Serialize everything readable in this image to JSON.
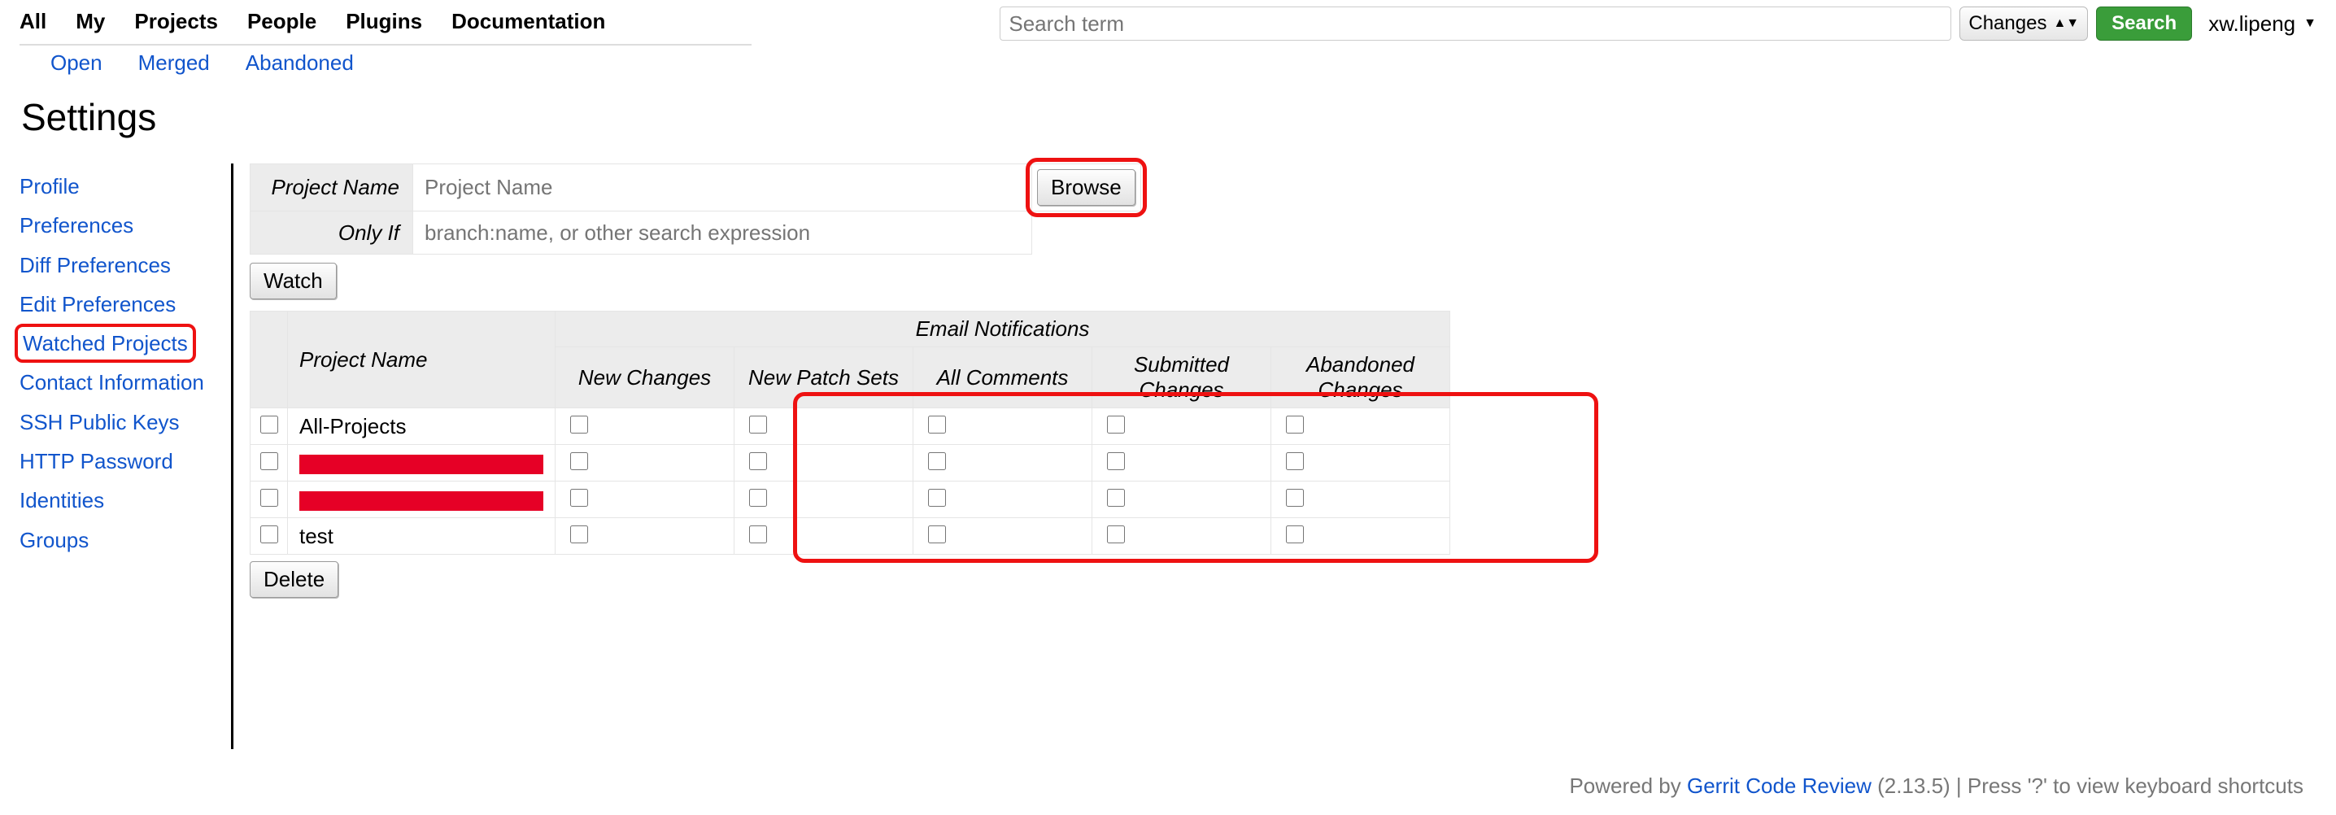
{
  "topnav": {
    "items": [
      "All",
      "My",
      "Projects",
      "People",
      "Plugins",
      "Documentation"
    ]
  },
  "search": {
    "placeholder": "Search term",
    "select_label": "Changes",
    "button": "Search"
  },
  "user": {
    "name": "xw.lipeng"
  },
  "subnav": {
    "items": [
      "Open",
      "Merged",
      "Abandoned"
    ]
  },
  "page_title": "Settings",
  "sidebar": {
    "items": [
      {
        "label": "Profile",
        "selected": false
      },
      {
        "label": "Preferences",
        "selected": false
      },
      {
        "label": "Diff Preferences",
        "selected": false
      },
      {
        "label": "Edit Preferences",
        "selected": false
      },
      {
        "label": "Watched Projects",
        "selected": true
      },
      {
        "label": "Contact Information",
        "selected": false
      },
      {
        "label": "SSH Public Keys",
        "selected": false
      },
      {
        "label": "HTTP Password",
        "selected": false
      },
      {
        "label": "Identities",
        "selected": false
      },
      {
        "label": "Groups",
        "selected": false
      }
    ]
  },
  "form": {
    "project_name_label": "Project Name",
    "project_name_placeholder": "Project Name",
    "only_if_label": "Only If",
    "only_if_placeholder": "branch:name, or other search expression",
    "browse": "Browse",
    "watch": "Watch"
  },
  "table": {
    "col_project": "Project Name",
    "col_group": "Email Notifications",
    "cols": [
      "New Changes",
      "New Patch Sets",
      "All Comments",
      "Submitted Changes",
      "Abandoned Changes"
    ],
    "rows": [
      {
        "name": "All-Projects",
        "redacted": false
      },
      {
        "name": "",
        "redacted": true
      },
      {
        "name": "",
        "redacted": true
      },
      {
        "name": "test",
        "redacted": false
      }
    ],
    "delete": "Delete"
  },
  "footer": {
    "prefix": "Powered by ",
    "link": "Gerrit Code Review",
    "version": " (2.13.5) | Press '?' to view keyboard shortcuts"
  }
}
